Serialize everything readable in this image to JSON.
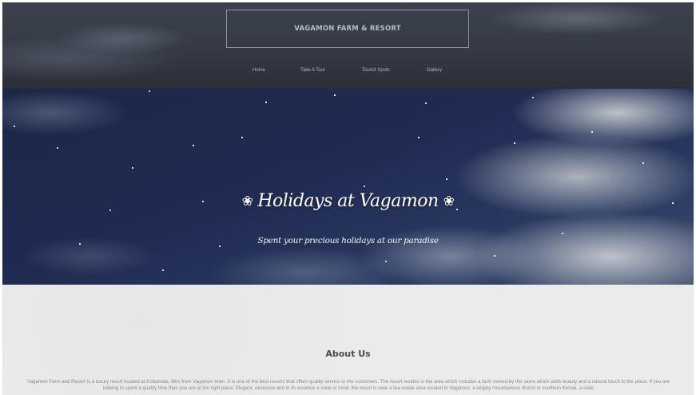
{
  "header": {
    "brand": "VAGAMON FARM & RESORT",
    "nav": [
      {
        "label": "Home"
      },
      {
        "label": "Take A Tour"
      },
      {
        "label": "Tourist Spots"
      },
      {
        "label": "Gallery"
      }
    ]
  },
  "hero": {
    "title": "Holidays at Vagamon",
    "leaf_icon": "maple-leaf-icon",
    "subtitle": "Spent your precious holidays at our paradise"
  },
  "about": {
    "title": "About Us",
    "text": "Vagamon Farm and Resort is a luxury resort located at Kottamala, 9km from Vagamon town. It is one of the best resorts that offers quality service to the customers. The resort resides in the area which includes a farm owned by the same which adds beauty and a natural touch to the place. If you are looking to spent a quality time then you are at the right place. Elegant, exclusive and in its essence a state of mind, the resort is near a tea estate area located in Vagamon, a largely mountainous district in southern Kerala, a state"
  },
  "colors": {
    "header_bg": "#353a45",
    "hero_bg": "#202b52",
    "about_bg": "#ebebeb"
  }
}
